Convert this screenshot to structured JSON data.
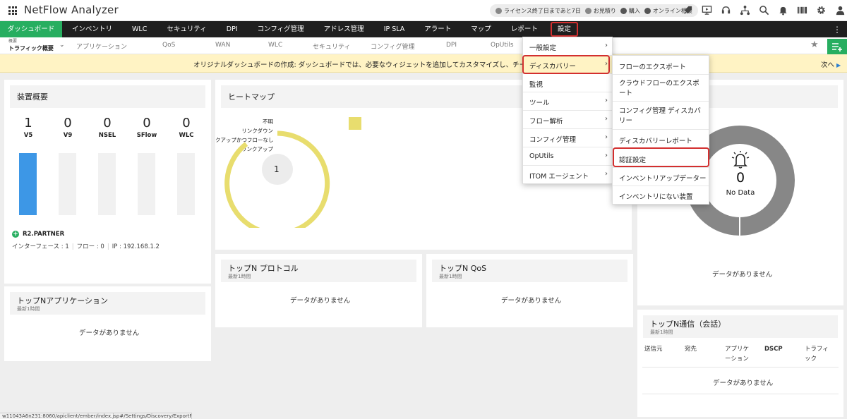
{
  "header": {
    "app_title": "NetFlow Analyzer",
    "pills": [
      {
        "icon": "license-icon",
        "label": "ライセンス終了日まであと7日"
      },
      {
        "icon": "quote-icon",
        "label": "お見積り"
      },
      {
        "icon": "purchase-icon",
        "label": "購入"
      },
      {
        "icon": "consult-icon",
        "label": "オンライン相談"
      }
    ]
  },
  "mainnav": {
    "tabs": [
      "ダッシュボード",
      "インベントリ",
      "WLC",
      "セキュリティ",
      "DPI",
      "コンフィグ管理",
      "アドレス管理",
      "IP SLA",
      "アラート",
      "マップ",
      "レポート",
      "設定"
    ]
  },
  "subnav": {
    "current_small": "概要",
    "current_main": "トラフィック概要",
    "items": [
      "アプリケーション",
      "QoS",
      "WAN",
      "WLC",
      "セキュリティ",
      "コンフィグ管理",
      "DPI",
      "OpUtils"
    ]
  },
  "banner": {
    "text": "オリジナルダッシュボードの作成: ダッシュボードでは、必要なウィジェットを追加してカスタマイズし、チームと共有",
    "next": "次へ"
  },
  "device_overview": {
    "title": "装置概要",
    "columns": [
      {
        "value": "1",
        "label": "V5",
        "fill": 1.0
      },
      {
        "value": "0",
        "label": "V9",
        "fill": 0
      },
      {
        "value": "0",
        "label": "NSEL",
        "fill": 0
      },
      {
        "value": "0",
        "label": "SFlow",
        "fill": 0
      },
      {
        "value": "0",
        "label": "WLC",
        "fill": 0
      }
    ],
    "partner": "R2.PARTNER",
    "interface_label": "インターフェース : 1",
    "flow_label": "フロー : 0",
    "ip_label": "IP : 192.168.1.2"
  },
  "heatmap": {
    "title": "ヒートマップ",
    "legend": [
      "不明",
      "リンクダウン",
      "クアップかつフローなし",
      "リンクアップ"
    ],
    "center_value": "1",
    "ring_color": "#e8dd6e"
  },
  "top_apps": {
    "title": "トップNアプリケーション",
    "sub": "最新1時間",
    "nodata": "データがありません"
  },
  "top_protocol": {
    "title": "トップN プロトコル",
    "sub": "最新1時間",
    "nodata": "データがありません"
  },
  "top_qos": {
    "title": "トップN QoS",
    "sub": "最新1時間",
    "nodata": "データがありません"
  },
  "alarms": {
    "value": "0",
    "label": "No Data",
    "nodata": "データがありません"
  },
  "top_comm": {
    "title": "トップN通信（会話）",
    "sub": "最新1時間",
    "columns": [
      "送信元",
      "宛先",
      "アプリケーション",
      "DSCP",
      "トラフィック"
    ],
    "nodata": "データがありません"
  },
  "settings_menu": {
    "items": [
      {
        "label": "一般設定",
        "submenu": true
      },
      {
        "label": "ディスカバリー",
        "submenu": true
      },
      {
        "label": "監視",
        "submenu": false
      },
      {
        "label": "ツール",
        "submenu": true
      },
      {
        "label": "フロー解析",
        "submenu": true
      },
      {
        "label": "コンフィグ管理",
        "submenu": true
      },
      {
        "label": "OpUtils",
        "submenu": true
      },
      {
        "label": "ITOM エージェント",
        "submenu": true
      }
    ]
  },
  "discovery_menu": {
    "items": [
      "フローのエクスポート",
      "クラウドフローのエクスポート",
      "コンフィグ管理 ディスカバリー",
      "ディスカバリーレポート",
      "認証設定",
      "インベントリアップデーター",
      "インベントリにない装置"
    ]
  },
  "status_url": "w11043A6n231:8060/apiclient/ember/index.jsp#/Settings/Discovery/ExportFlow"
}
